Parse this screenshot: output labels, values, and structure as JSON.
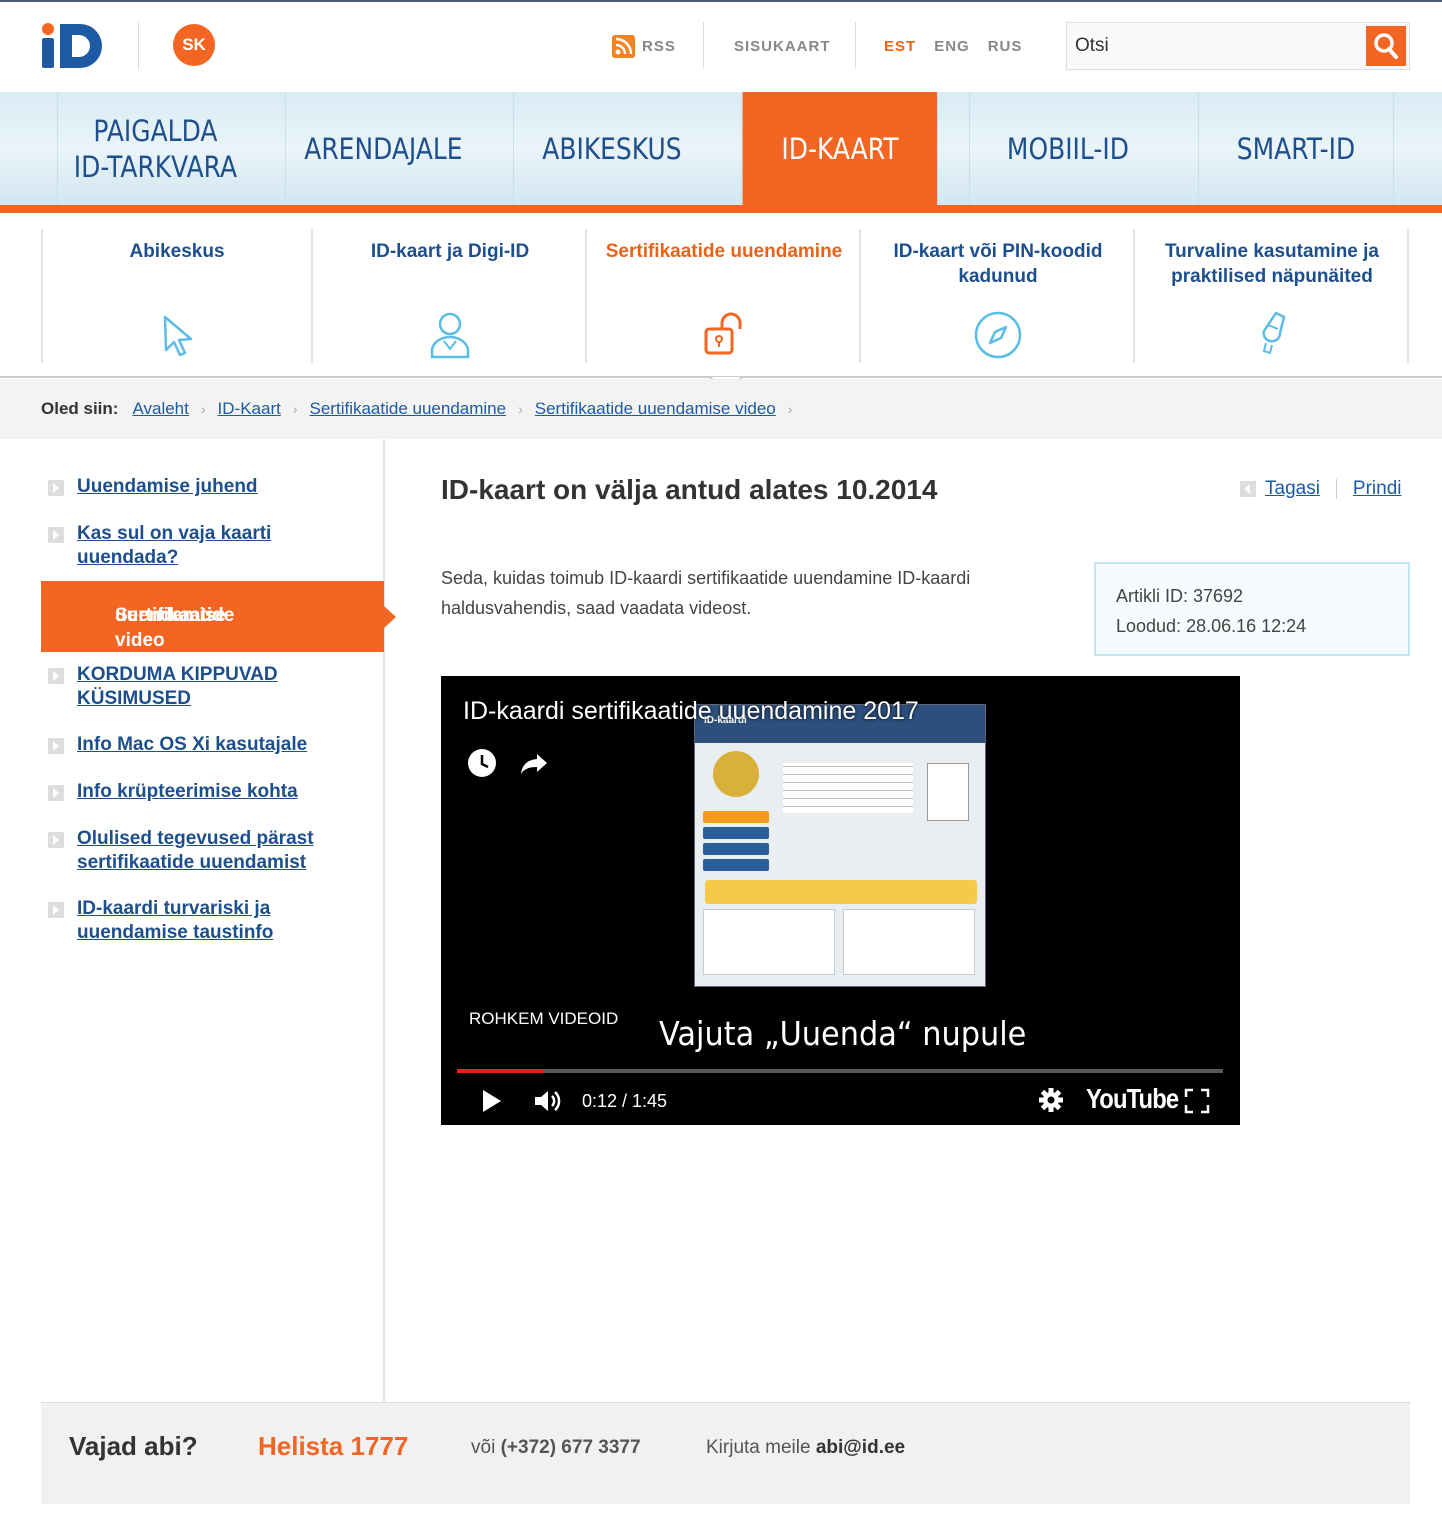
{
  "header": {
    "logo_id": "iD",
    "logo_sk": "SK",
    "rss_label": "RSS",
    "sitemap_label": "SISUKAART",
    "languages": [
      "EST",
      "ENG",
      "RUS"
    ],
    "active_language": "EST",
    "search_placeholder": "Otsi"
  },
  "main_nav": [
    {
      "label_line1": "PAIGALDA",
      "label_line2": "ID-TARKVARA"
    },
    {
      "label_line1": "ARENDAJALE",
      "label_line2": ""
    },
    {
      "label_line1": "ABIKESKUS",
      "label_line2": ""
    },
    {
      "label_line1": "ID-KAART",
      "label_line2": "",
      "active": true
    },
    {
      "label_line1": "MOBIIL-ID",
      "label_line2": ""
    },
    {
      "label_line1": "SMART-ID",
      "label_line2": ""
    }
  ],
  "sub_nav": [
    {
      "label": "Abikeskus",
      "icon": "cursor-icon"
    },
    {
      "label": "ID-kaart ja Digi-ID",
      "icon": "user-icon"
    },
    {
      "label": "Sertifikaatide uuendamine",
      "icon": "unlock-icon",
      "active": true
    },
    {
      "label": "ID-kaart või PIN-koodid kadunud",
      "icon": "compass-icon"
    },
    {
      "label": "Turvaline kasutamine ja praktilised näpunäited",
      "icon": "hint-icon"
    }
  ],
  "breadcrumb": {
    "lead": "Oled siin:",
    "items": [
      "Avaleht",
      "ID-Kaart",
      "Sertifikaatide uuendamine",
      "Sertifikaatide uuendamise video"
    ]
  },
  "sidebar": {
    "items": [
      "Uuendamise juhend",
      "Kas sul on vaja kaarti uuendada?",
      "KORDUMA KIPPUVAD KÜSIMUSED",
      "Info Mac OS Xi kasutajale",
      "Info krüpteerimise kohta",
      "Olulised tegevused pärast sertifikaatide uuendamist",
      "ID-kaardi turvariski ja uuendamise taustinfo"
    ],
    "active_line1": "Sertifikaatide",
    "active_line2": "uuendamise video"
  },
  "article": {
    "title": "ID-kaart on välja antud alates 10.2014",
    "back_label": "Tagasi",
    "print_label": "Prindi",
    "intro": "Seda, kuidas toimub ID-kaardi sertifikaatide uuendamine ID-kaardi haldusvahendis, saad vaadata videost.",
    "article_id": "Artikli ID: 37692",
    "created": "Loodud: 28.06.16 12:24"
  },
  "video": {
    "title": "ID-kaardi sertifikaatide uuendamine 2017",
    "screenshot_header": "ID-kaardi",
    "more_videos": "ROHKEM VIDEOID",
    "caption": "Vajuta „Uuenda“ nupule",
    "time": "0:12 / 1:45",
    "progress": 0.114,
    "brand": "YouTube",
    "progress_color": "#e62117"
  },
  "footer": {
    "help": "Vajad abi?",
    "phone": "Helista 1777",
    "alt_prefix": "või",
    "alt_phone": "(+372) 677 3377",
    "mail_prefix": "Kirjuta meile",
    "mail": "abi@id.ee"
  },
  "colors": {
    "accent": "#f26522",
    "link": "#1e4f8d",
    "nav_bg": "#e1eff6"
  }
}
